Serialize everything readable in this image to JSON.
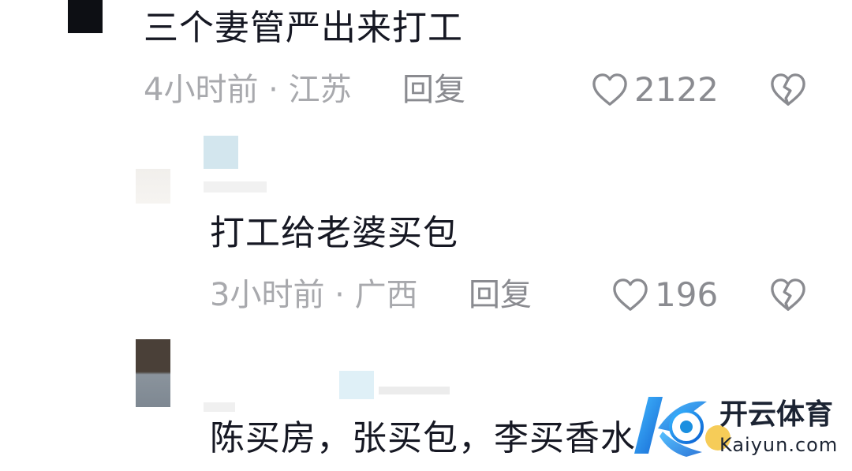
{
  "comments": [
    {
      "text": "三个妻管严出来打工",
      "time": "4小时前",
      "separator": "·",
      "location": "江苏",
      "reply_label": "回复",
      "likes": "2122"
    },
    {
      "text": "打工给老婆买包",
      "time": "3小时前",
      "separator": "·",
      "location": "广西",
      "reply_label": "回复",
      "likes": "196"
    },
    {
      "text": "陈买房，张买包，李买香水"
    }
  ],
  "icons": {
    "like": "heart-outline-icon",
    "dislike": "broken-heart-icon"
  },
  "watermark": {
    "title": "开云体育",
    "subtitle": "Kaiyun.com"
  },
  "colors": {
    "text": "#161823",
    "meta": "#a8a9ad",
    "action": "#8a8b90",
    "brand_blue": "#1a8fe0"
  }
}
